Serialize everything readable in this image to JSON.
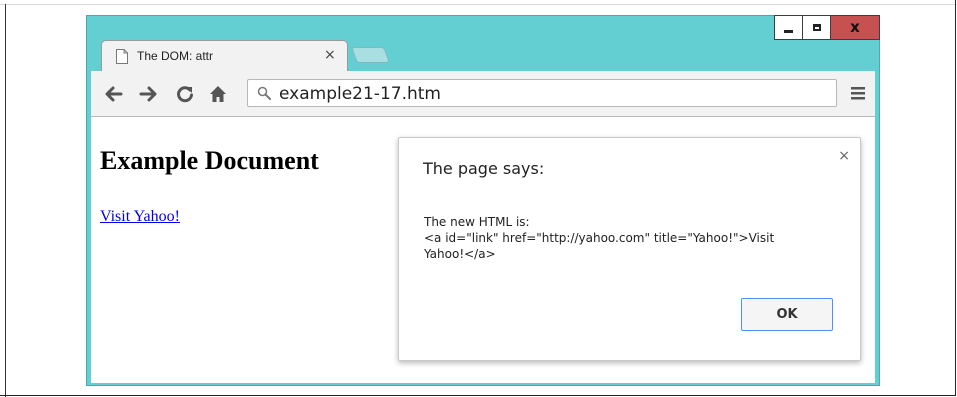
{
  "browser": {
    "tab_title": "The DOM: attr",
    "tab_close": "×",
    "address_bar_text": "example21-17.htm",
    "window_close": "x"
  },
  "page": {
    "heading": "Example Document",
    "link_text": "Visit Yahoo!"
  },
  "alert": {
    "title": "The page says:",
    "close": "×",
    "message": "The new HTML is:\n<a id=\"link\" href=\"http://yahoo.com\" title=\"Yahoo!\">Visit\nYahoo!</a>",
    "ok_label": "OK"
  },
  "colors": {
    "frame": "#63cfd2",
    "close_button": "#c75050",
    "link": "#0000ee",
    "ok_border": "#4d90fe"
  },
  "icons": [
    "page-icon",
    "back-icon",
    "forward-icon",
    "reload-icon",
    "home-icon",
    "search-icon",
    "menu-icon"
  ]
}
